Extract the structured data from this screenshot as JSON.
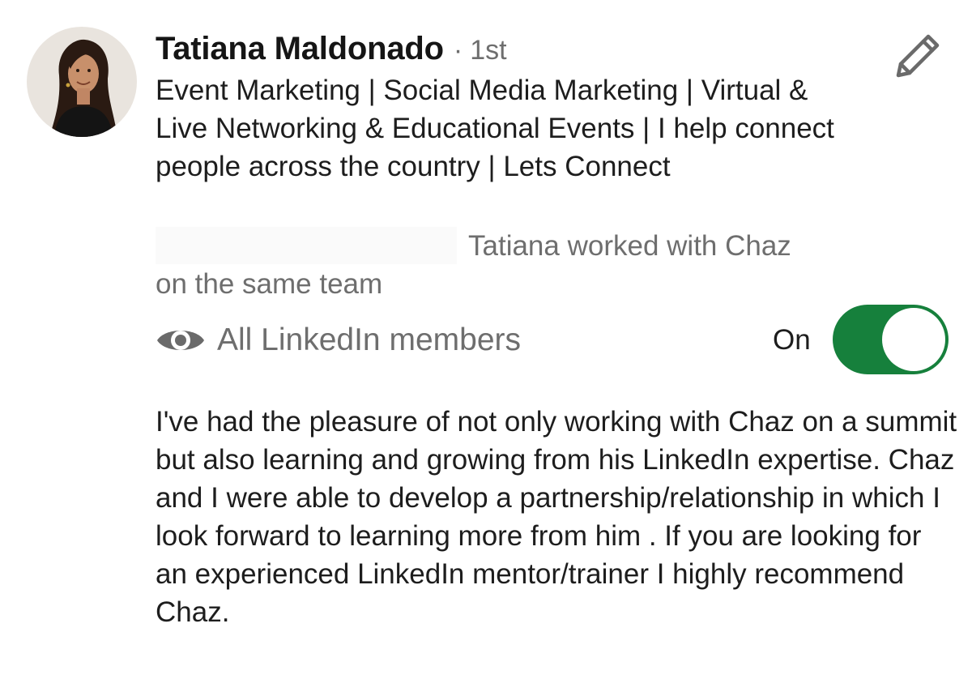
{
  "profile": {
    "name": "Tatiana Maldonado",
    "separator": "·",
    "degree": "1st",
    "headline": "Event Marketing | Social Media Marketing | Virtual & Live Networking & Educational Events | I help connect people across the country | Lets Connect",
    "relationship": "Tatiana worked with Chaz on the same team"
  },
  "visibility": {
    "icon": "eye-icon",
    "label": "All LinkedIn members"
  },
  "toggle": {
    "label": "On",
    "state": "on",
    "color": "#16803c"
  },
  "recommendation": {
    "text": "I've had the pleasure of not only working with Chaz on a summit but also learning and growing from his LinkedIn expertise. Chaz and I were able to develop a partnership/relationship in which I look forward to learning more from him . If you are looking for an experienced LinkedIn mentor/trainer I highly recommend Chaz."
  },
  "icons": {
    "edit": "pencil-icon"
  }
}
